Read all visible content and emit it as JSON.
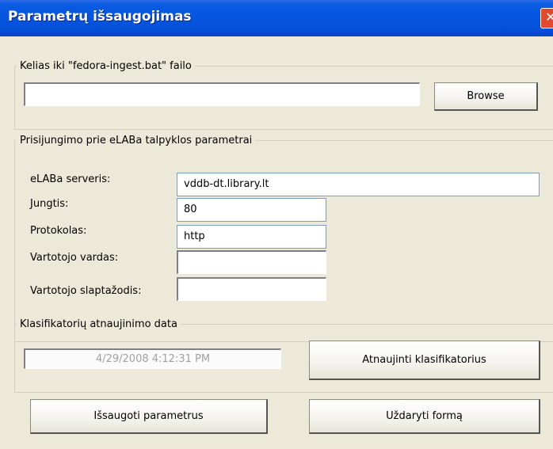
{
  "window": {
    "title": "Parametrų išsaugojimas",
    "close_glyph": "✕"
  },
  "path_group": {
    "legend": "Kelias iki \"fedora-ingest.bat\" failo",
    "path_value": "",
    "browse_label": "Browse"
  },
  "connection_group": {
    "legend": "Prisijungimo prie eLABa talpyklos parametrai",
    "fields": [
      {
        "label": "eLABa serveris:",
        "value": "vddb-dt.library.lt"
      },
      {
        "label": "Jungtis:",
        "value": "80"
      },
      {
        "label": "Protokolas:",
        "value": "http"
      },
      {
        "label": "Vartotojo vardas:",
        "value": ""
      },
      {
        "label": "Vartotojo slaptažodis:",
        "value": ""
      }
    ]
  },
  "classifier_group": {
    "legend": "Klasifikatorių atnaujinimo data",
    "date_value": "4/29/2008 4:12:31 PM",
    "refresh_label": "Atnaujinti klasifikatorius"
  },
  "footer": {
    "save_label": "Išsaugoti parametrus",
    "close_label": "Uždaryti formą"
  },
  "colors": {
    "titlebar": "#0755df",
    "dialog_bg": "#ece9d8",
    "close_button": "#e2492f"
  }
}
